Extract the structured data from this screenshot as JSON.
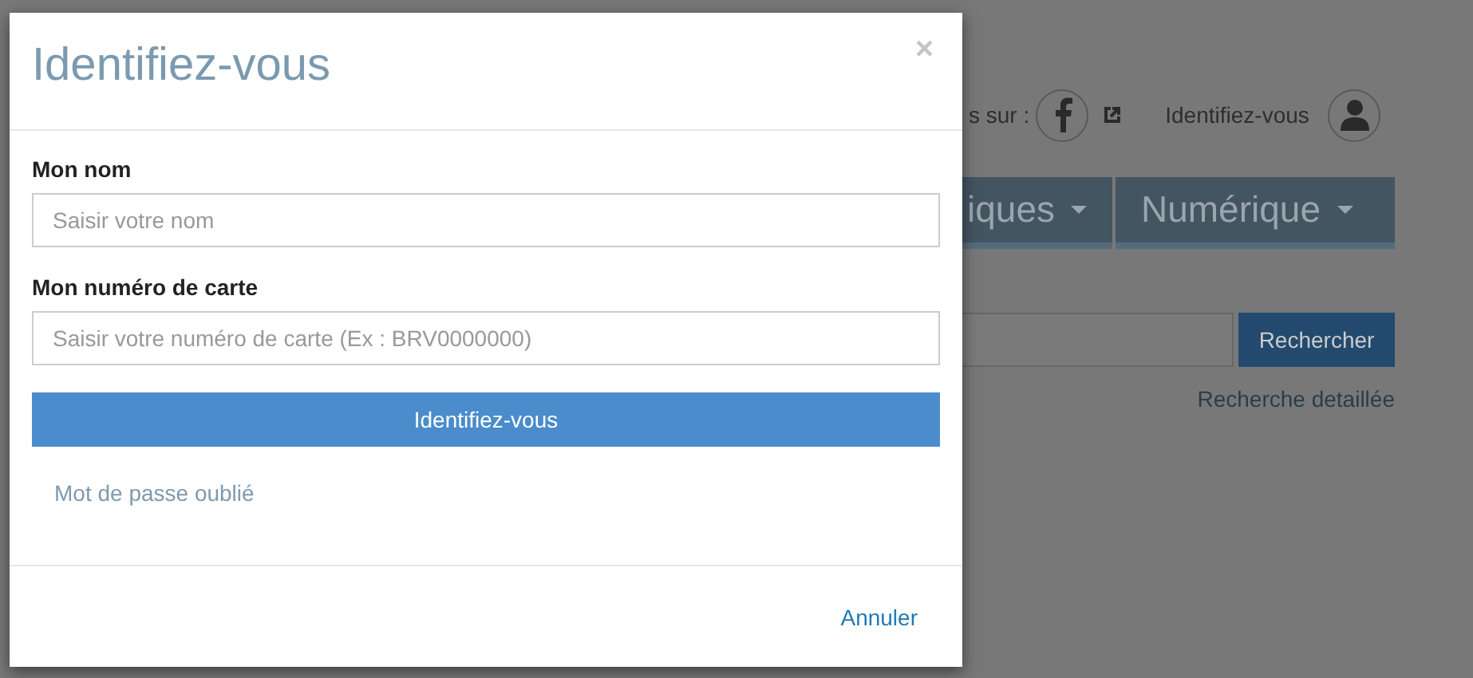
{
  "background": {
    "follow_label": "s sur :",
    "login_label": "Identifiez-vous",
    "nav": [
      {
        "label": "iques"
      },
      {
        "label": "Numérique"
      }
    ],
    "search_button": "Rechercher",
    "advanced_search": "Recherche detaillée"
  },
  "dialog": {
    "title": "Identifiez-vous",
    "close": "×",
    "fields": [
      {
        "label": "Mon nom",
        "placeholder": "Saisir votre nom"
      },
      {
        "label": "Mon numéro de carte",
        "placeholder": "Saisir votre numéro de carte (Ex : BRV0000000)"
      }
    ],
    "submit": "Identifiez-vous",
    "forgot": "Mot de passe oublié",
    "cancel": "Annuler"
  }
}
